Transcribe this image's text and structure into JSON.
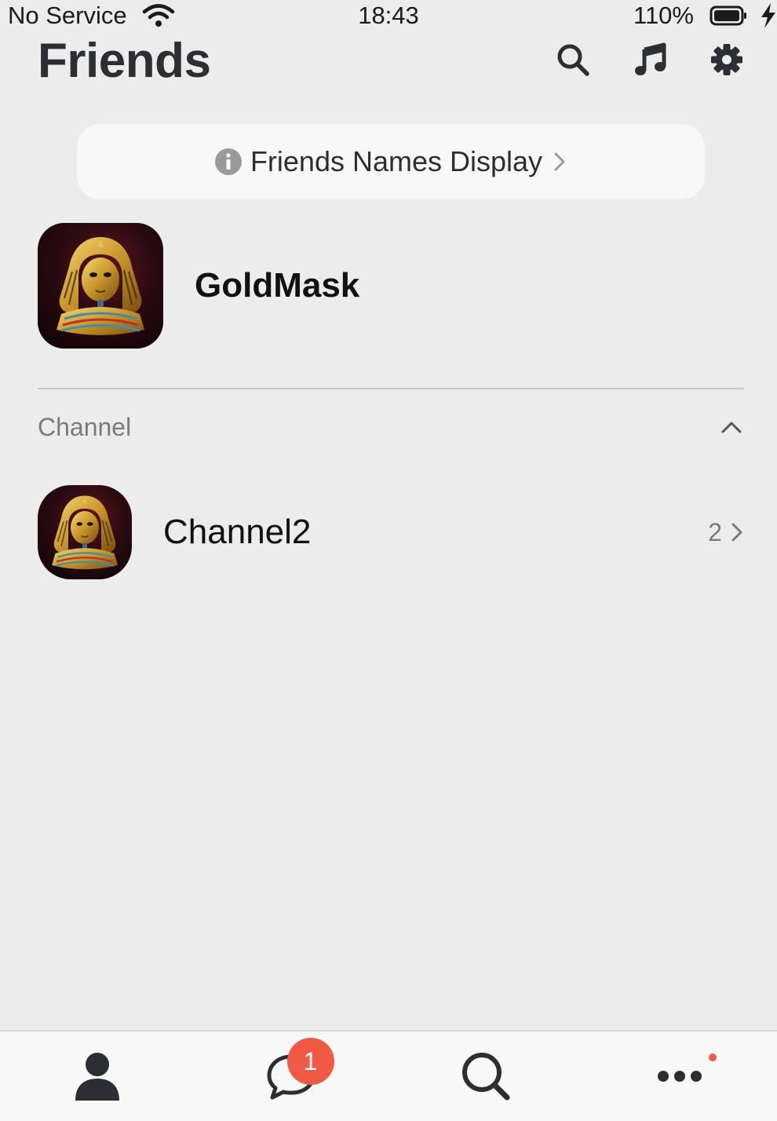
{
  "status_bar": {
    "carrier": "No Service",
    "time": "18:43",
    "battery": "110%"
  },
  "header": {
    "title": "Friends",
    "icons": [
      "search-icon",
      "music-note-icon",
      "gear-icon"
    ]
  },
  "names_display": {
    "label": "Friends Names Display"
  },
  "profile": {
    "name": "GoldMask"
  },
  "channel_section": {
    "title": "Channel",
    "items": [
      {
        "name": "Channel2",
        "count": "2"
      }
    ]
  },
  "tab_bar": {
    "tabs": [
      "friends-tab",
      "chats-tab",
      "discover-tab",
      "more-tab"
    ],
    "chats_badge": "1"
  },
  "colors": {
    "background": "#ececec",
    "badge": "#f05a44",
    "text_dark": "#2b2f33",
    "text_muted": "#7b7b7b"
  }
}
